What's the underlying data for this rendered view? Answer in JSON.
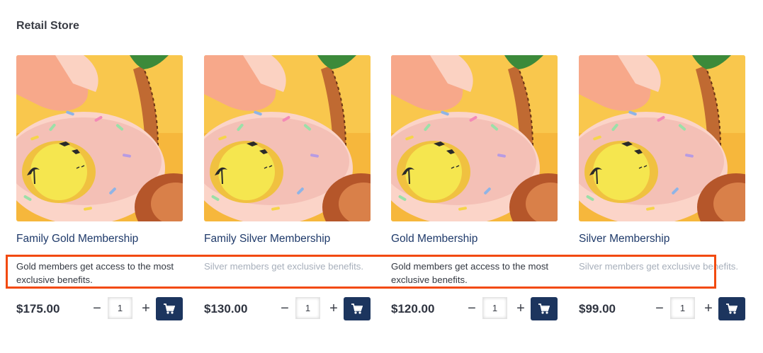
{
  "store": {
    "title": "Retail Store"
  },
  "colors": {
    "accent": "#1c355e",
    "highlight": "#f24a0f",
    "muted_text": "#a7afbb",
    "image_bg": "#f6b73c"
  },
  "products": [
    {
      "name": "Family Gold Membership",
      "description": "Gold members get access to the most exclusive benefits.",
      "description_muted": false,
      "price": "$175.00",
      "quantity": "1",
      "image_icon": "donut-float-palm-tree-image"
    },
    {
      "name": "Family Silver Membership",
      "description": "Silver members get exclusive benefits.",
      "description_muted": true,
      "price": "$130.00",
      "quantity": "1",
      "image_icon": "donut-float-palm-tree-image"
    },
    {
      "name": "Gold Membership",
      "description": "Gold members get access to the most exclusive benefits.",
      "description_muted": false,
      "price": "$120.00",
      "quantity": "1",
      "image_icon": "donut-float-palm-tree-image"
    },
    {
      "name": "Silver Membership",
      "description": "Silver members get exclusive benefits.",
      "description_muted": true,
      "price": "$99.00",
      "quantity": "1",
      "image_icon": "donut-float-palm-tree-image"
    }
  ],
  "controls": {
    "minus_symbol": "−",
    "plus_symbol": "+",
    "cart_icon": "shopping-cart-icon"
  }
}
